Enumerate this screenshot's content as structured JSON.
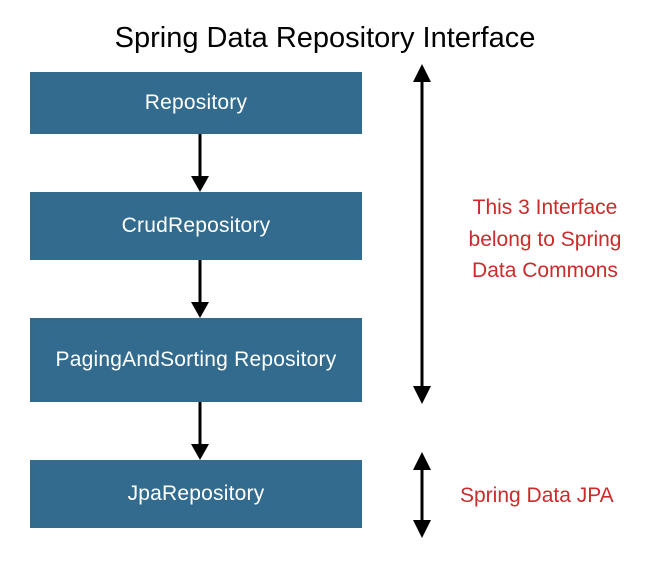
{
  "title": "Spring Data Repository Interface",
  "boxes": {
    "b1": "Repository",
    "b2": "CrudRepository",
    "b3": "PagingAndSorting Repository",
    "b4": "JpaRepository"
  },
  "annotations": {
    "a1": "This 3 Interface belong to Spring Data Commons",
    "a2": "Spring Data JPA"
  },
  "colors": {
    "box_bg": "#336b8e",
    "box_text": "#ffffff",
    "annotation_text": "#cc2b2b"
  }
}
